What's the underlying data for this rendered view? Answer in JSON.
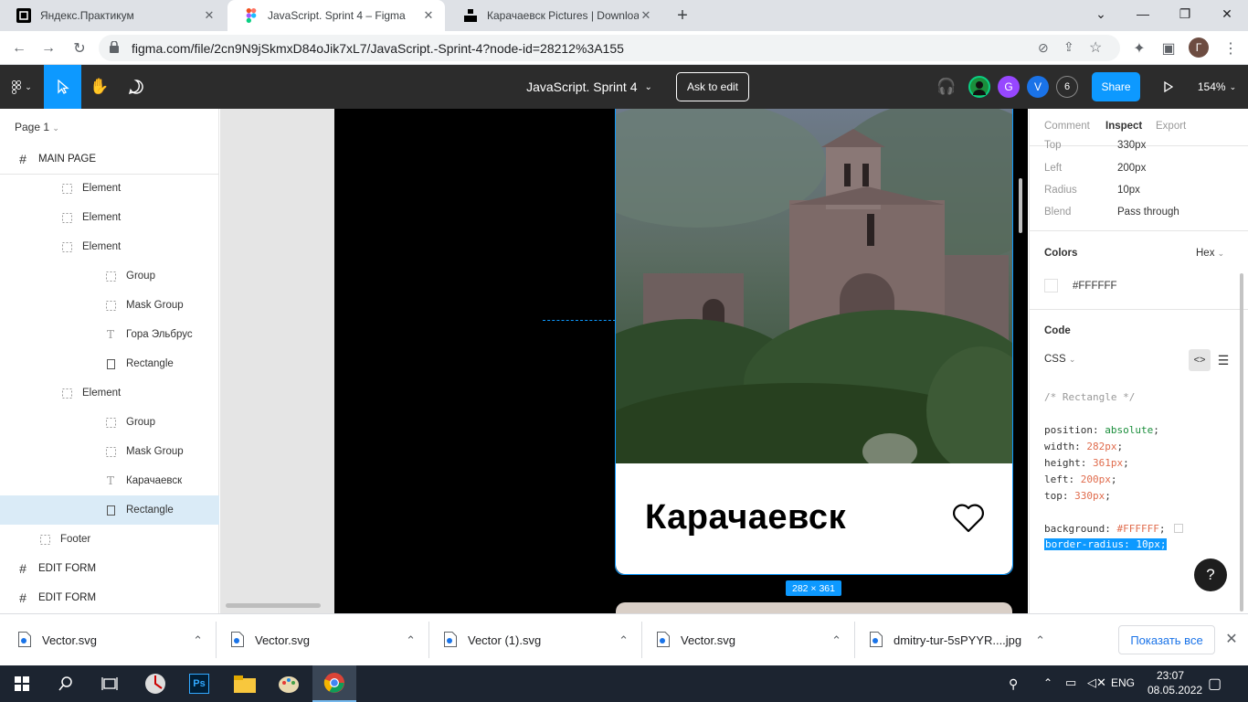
{
  "browser": {
    "tabs": [
      {
        "title": "Яндекс.Практикум",
        "favicon": "practicum-icon"
      },
      {
        "title": "JavaScript. Sprint 4 – Figma",
        "favicon": "figma-icon"
      },
      {
        "title": "Карачаевск Pictures | Download",
        "favicon": "unsplash-icon"
      }
    ],
    "new_tab": "+",
    "url": "figma.com/file/2cn9N9jSkmxD84oJik7xL7/JavaScript.-Sprint-4?node-id=28212%3A155",
    "profile_initial": "Г"
  },
  "figma": {
    "file_title": "JavaScript. Sprint 4",
    "ask_to_edit": "Ask to edit",
    "share": "Share",
    "zoom": "154%",
    "avatars": [
      {
        "initial": "G",
        "color": "#9747ff"
      },
      {
        "initial": "V",
        "color": "#1a73e8"
      }
    ],
    "avatar_count": "6"
  },
  "left_panel": {
    "page": "Page 1",
    "layers": [
      {
        "label": "MAIN PAGE",
        "type": "frame",
        "indent": 0
      },
      {
        "label": "Element",
        "type": "group",
        "indent": 1
      },
      {
        "label": "Element",
        "type": "group",
        "indent": 1
      },
      {
        "label": "Element",
        "type": "group",
        "indent": 1
      },
      {
        "label": "Group",
        "type": "group",
        "indent": 2
      },
      {
        "label": "Mask Group",
        "type": "group",
        "indent": 2
      },
      {
        "label": "Гора Эльбрус",
        "type": "text",
        "indent": 2
      },
      {
        "label": "Rectangle",
        "type": "rect",
        "indent": 2
      },
      {
        "label": "Element",
        "type": "group",
        "indent": 1
      },
      {
        "label": "Group",
        "type": "group",
        "indent": 2
      },
      {
        "label": "Mask Group",
        "type": "group",
        "indent": 2
      },
      {
        "label": "Карачаевск",
        "type": "text",
        "indent": 2
      },
      {
        "label": "Rectangle",
        "type": "rect",
        "indent": 2,
        "selected": true
      },
      {
        "label": "Footer",
        "type": "group",
        "indent": 0.5
      },
      {
        "label": "EDIT FORM",
        "type": "frame",
        "indent": 0
      },
      {
        "label": "EDIT FORM",
        "type": "frame",
        "indent": 0
      }
    ]
  },
  "canvas": {
    "card_title": "Карачаевск",
    "size_label": "282 × 361"
  },
  "right_panel": {
    "tabs": [
      "Comment",
      "Inspect",
      "Export"
    ],
    "props": [
      {
        "label": "Top",
        "value": "330px"
      },
      {
        "label": "Left",
        "value": "200px"
      },
      {
        "label": "Radius",
        "value": "10px"
      },
      {
        "label": "Blend",
        "value": "Pass through"
      }
    ],
    "colors_label": "Colors",
    "color_format": "Hex",
    "color_value": "#FFFFFF",
    "code_label": "Code",
    "code_lang": "CSS",
    "code_comment": "/* Rectangle */",
    "code_lines": [
      {
        "prop": "position",
        "val": "absolute",
        "kind": "kw"
      },
      {
        "prop": "width",
        "val": "282px",
        "kind": "num"
      },
      {
        "prop": "height",
        "val": "361px",
        "kind": "num"
      },
      {
        "prop": "left",
        "val": "200px",
        "kind": "num"
      },
      {
        "prop": "top",
        "val": "330px",
        "kind": "num"
      }
    ],
    "code_bg_prop": "background",
    "code_bg_val": "#FFFFFF",
    "code_selected": "border-radius: 10px;",
    "help": "?"
  },
  "downloads": {
    "items": [
      "Vector.svg",
      "Vector.svg",
      "Vector (1).svg",
      "Vector.svg",
      "dmitry-tur-5sPYYR....jpg"
    ],
    "show_all": "Показать все"
  },
  "taskbar": {
    "lang": "ENG",
    "time": "23:07",
    "date": "08.05.2022"
  }
}
